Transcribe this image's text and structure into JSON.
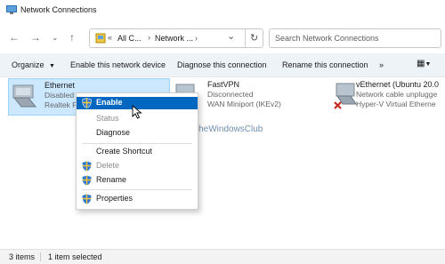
{
  "window": {
    "title": "Network Connections"
  },
  "nav": {
    "breadcrumb": [
      "All C...",
      "Network ..."
    ],
    "breadcrumb_prefix": "«",
    "search_placeholder": "Search Network Connections"
  },
  "toolbar": {
    "organize": "Organize",
    "enable": "Enable this network device",
    "diagnose": "Diagnose this connection",
    "rename": "Rename this connection",
    "more": "»"
  },
  "items": [
    {
      "name": "Ethernet",
      "status": "Disabled",
      "device": "Realtek P"
    },
    {
      "name": "FastVPN",
      "status": "Disconnected",
      "device": "WAN Miniport (IKEv2)"
    },
    {
      "name": "vEthernet (Ubuntu 20.0",
      "status": "Network cable unplugge",
      "device": "Hyper-V Virtual Etherne"
    }
  ],
  "context_menu": {
    "enable": "Enable",
    "status": "Status",
    "diagnose": "Diagnose",
    "create_shortcut": "Create Shortcut",
    "delete": "Delete",
    "rename": "Rename",
    "properties": "Properties"
  },
  "watermark": "TheWindowsClub",
  "statusbar": {
    "count": "3 items",
    "selected": "1 item selected"
  },
  "colors": {
    "accent": "#0067c0",
    "selection": "#cce8ff",
    "menu_highlight": "#0067c0",
    "error": "#c42b1c"
  }
}
